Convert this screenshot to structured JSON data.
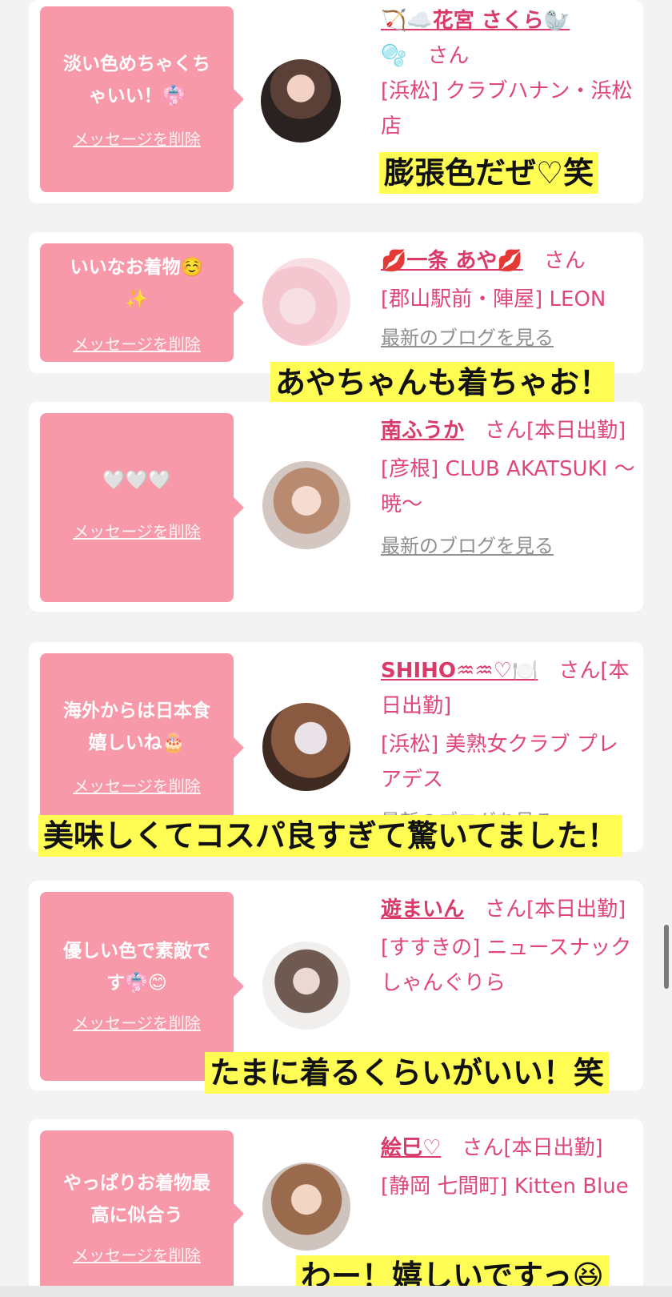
{
  "delete_label": "メッセージを削除",
  "blog_label": "最新のブログを見る",
  "honorific": "さん",
  "colors": {
    "bubble": "#f899aa",
    "accent": "#e0457b",
    "caption_bg": "#fffd54"
  },
  "cards": [
    {
      "message": "淡い色めちゃくち\nゃいい！👘",
      "name": "🏹☁️花宮 さくら🦭",
      "name_line2": "🫧",
      "san": "さん",
      "shop": "[浜松] クラブハナン・浜松店",
      "blog": "",
      "caption": "膨張色だぜ♡笑"
    },
    {
      "message": "いいなお着物☺️\n✨",
      "name": "💋一条 あや💋",
      "san": "さん",
      "shop": "[郡山駅前・陣屋] LEON",
      "blog": "最新のブログを見る",
      "caption": "あやちゃんも着ちゃお！"
    },
    {
      "message": "🤍🤍🤍",
      "name": "南ふうか",
      "san": "さん[本日出勤]",
      "shop": "[彦根] CLUB AKATSUKI 〜暁〜",
      "blog": "最新のブログを見る",
      "caption": ""
    },
    {
      "message": "海外からは日本食\n嬉しいね🎂",
      "name": "SHIHO♒♒♡🍽️",
      "san": "さん[本日出勤]",
      "shop": "[浜松] 美熟女クラブ プレアデス",
      "blog": "最新のブログを見る",
      "caption": "美味しくてコスパ良すぎて驚いてました！"
    },
    {
      "message": "優しい色で素敵で\nす👘😊",
      "name": "遊まいん",
      "san": "さん[本日出勤]",
      "shop": "[すすきの] ニュースナックしゃんぐりら",
      "blog": "",
      "caption": "たまに着るくらいがいい！笑"
    },
    {
      "message": "やっぱりお着物最\n高に似合う",
      "name": "絵巳♡",
      "san": "さん[本日出勤]",
      "shop": "[静岡 七間町] Kitten Blue",
      "blog": "",
      "caption": "わー！嬉しいですっ😆"
    }
  ]
}
